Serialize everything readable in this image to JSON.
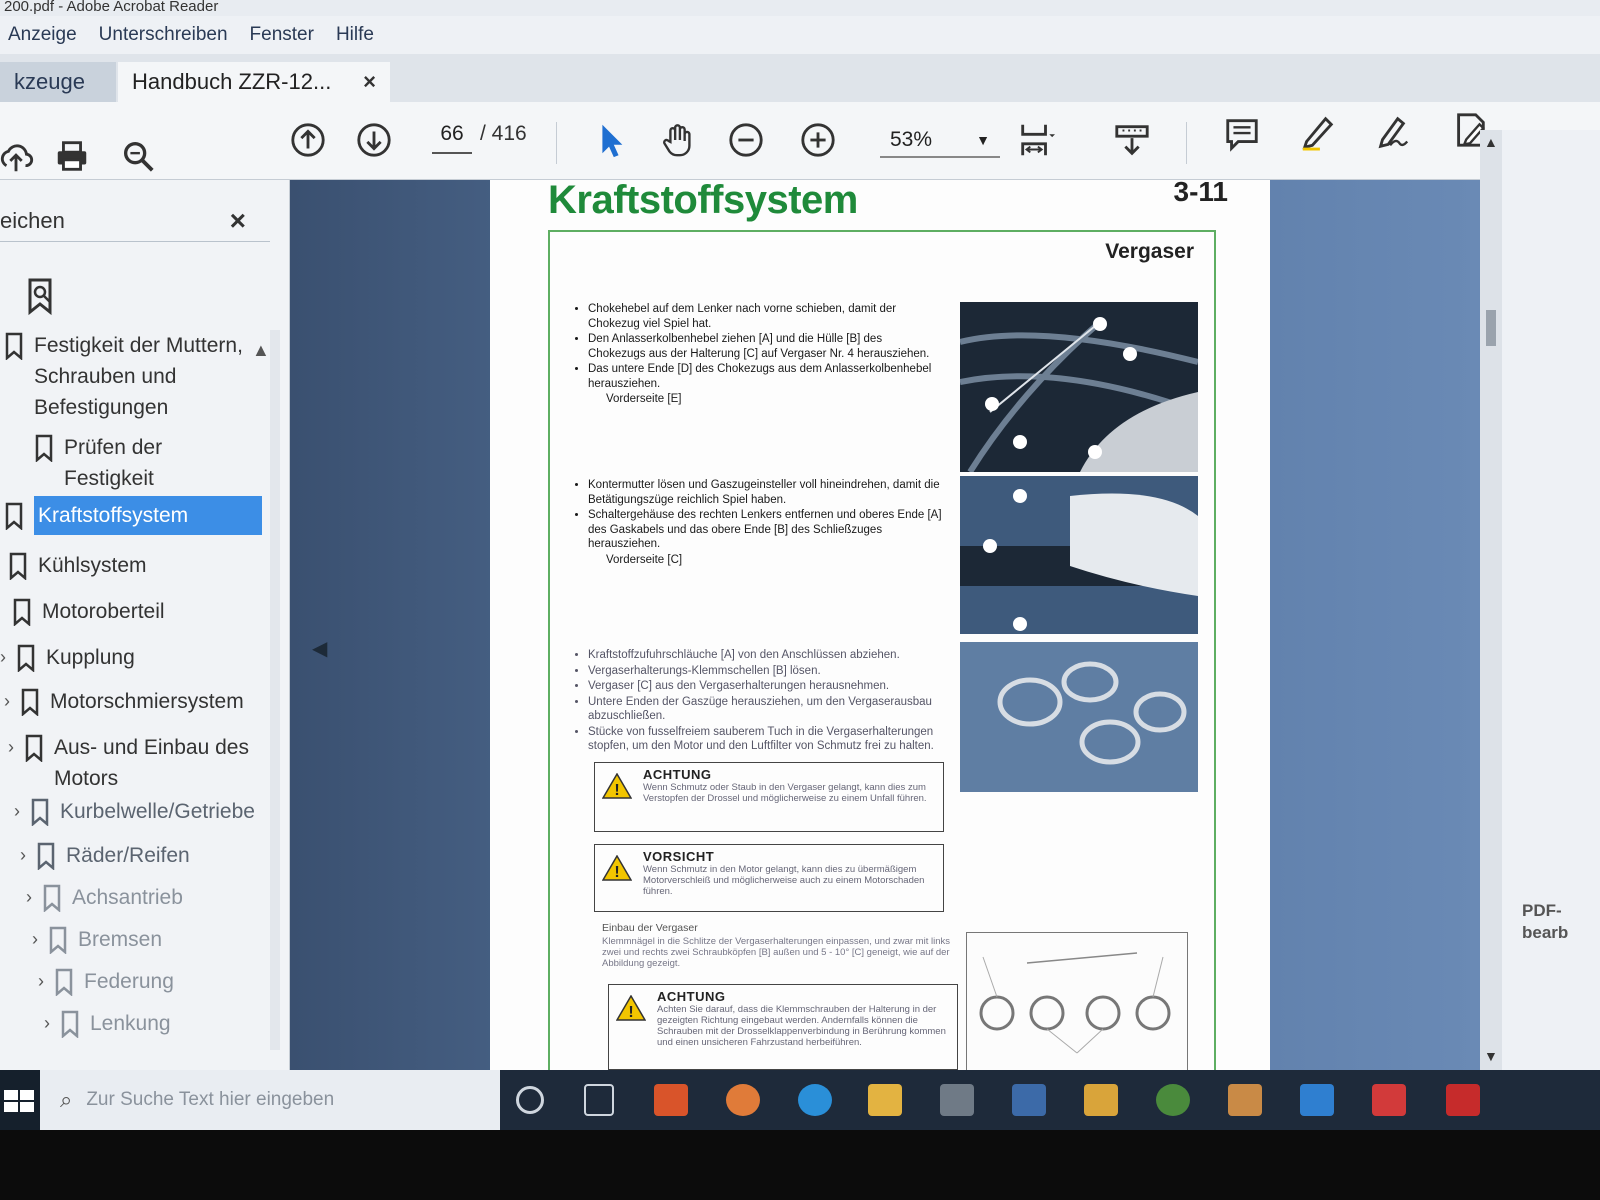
{
  "window": {
    "title": "200.pdf - Adobe Acrobat Reader"
  },
  "menu": [
    "Anzeige",
    "Unterschreiben",
    "Fenster",
    "Hilfe"
  ],
  "tabs": {
    "tools": "kzeuge",
    "document": "Handbuch ZZR-12...",
    "close_symbol": "×"
  },
  "toolbar": {
    "page_current": "66",
    "page_total": "/ 416",
    "zoom": "53%",
    "icons": [
      "upload-icon",
      "print-icon",
      "search-icon",
      "page-up-icon",
      "page-down-icon",
      "select-cursor-icon",
      "hand-icon",
      "zoom-out-icon",
      "zoom-in-icon",
      "fit-page-icon",
      "scroll-mode-icon",
      "comment-icon",
      "highlight-pen-icon",
      "sign-icon",
      "edit-pdf-icon"
    ]
  },
  "bookmarks_panel": {
    "header": "eichen",
    "close_symbol": "×",
    "items": [
      {
        "label": "Festigkeit der Muttern, Schrauben und Befestigungen"
      },
      {
        "label": "Prüfen der Festigkeit"
      },
      {
        "label": "Kraftstoffsystem"
      },
      {
        "label": "Kühlsystem"
      },
      {
        "label": "Motoroberteil"
      },
      {
        "label": "Kupplung"
      },
      {
        "label": "Motorschmiersystem"
      },
      {
        "label": "Aus- und Einbau des Motors"
      },
      {
        "label": "Kurbelwelle/Getriebe"
      },
      {
        "label": "Räder/Reifen"
      },
      {
        "label": "Achsantrieb"
      },
      {
        "label": "Bremsen"
      },
      {
        "label": "Federung"
      },
      {
        "label": "Lenkung"
      }
    ]
  },
  "page": {
    "title": "Kraftstoffsystem",
    "number": "3-11",
    "section": "Vergaser",
    "step1": [
      "Chokehebel auf dem Lenker nach vorne schieben, damit der Chokezug viel Spiel hat.",
      "Den Anlasserkolbenhebel ziehen [A] und die Hülle [B] des Chokezugs aus der Halterung [C] auf Vergaser Nr. 4 herausziehen.",
      "Das untere Ende [D] des Chokezugs aus dem Anlasserkolbenhebel herausziehen."
    ],
    "step1_sub": "Vorderseite [E]",
    "step2": [
      "Kontermutter lösen und Gaszugeinsteller voll hineindrehen, damit die Betätigungszüge reichlich Spiel haben.",
      "Schaltergehäuse des rechten Lenkers entfernen und oberes Ende [A] des Gaskabels und das obere Ende [B] des Schließzuges herausziehen."
    ],
    "step2_sub": "Vorderseite [C]",
    "step3": [
      "Kraftstoffzufuhrschläuche [A] von den Anschlüssen abziehen.",
      "Vergaserhalterungs-Klemmschellen [B] lösen.",
      "Vergaser [C] aus den Vergaserhalterungen herausnehmen.",
      "Untere Enden der Gaszüge herausziehen, um den Vergaserausbau abzuschließen.",
      "Stücke von fusselfreiem sauberem Tuch in die Vergaserhalterungen stopfen, um den Motor und den Luftfilter von Schmutz frei zu halten."
    ],
    "warning1": {
      "head": "ACHTUNG",
      "text": "Wenn Schmutz oder Staub in den Vergaser gelangt, kann dies zum Verstopfen der Drossel und möglicherweise zu einem Unfall führen."
    },
    "caution": {
      "head": "VORSICHT",
      "text": "Wenn Schmutz in den Motor gelangt, kann dies zu übermäßigem Motorverschleiß und möglicherweise auch zu einem Motorschaden führen."
    },
    "install_head": "Einbau der Vergaser",
    "install_text": "Klemmnägel in die Schlitze der Vergaserhalterungen einpassen, und zwar mit links zwei und rechts zwei Schraubköpfen [B] außen und 5 - 10° [C] geneigt, wie auf der Abbildung gezeigt.",
    "warning2": {
      "head": "ACHTUNG",
      "text": "Achten Sie darauf, dass die Klemmschrauben der Halterung in der gezeigten Richtung eingebaut werden. Andernfalls können die Schrauben mit der Drosselklappenverbindung in Berührung kommen und einen unsicheren Fahrzustand herbeiführen."
    }
  },
  "right_pane": {
    "pdf_edit": "PDF-\nbearb"
  },
  "taskbar": {
    "search_placeholder": "Zur Suche Text hier eingeben"
  },
  "colors": {
    "title_green": "#1f8a3a",
    "frame_green": "#5eae62",
    "selection_blue": "#3c8ee6",
    "warn_yellow": "#f2c500"
  }
}
